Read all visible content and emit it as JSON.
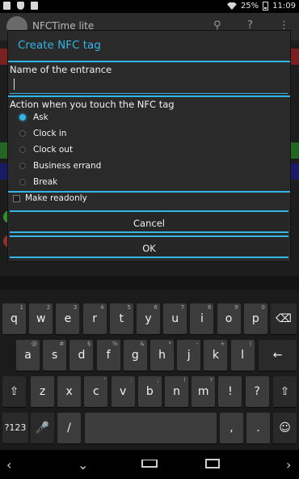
{
  "status_bar": {
    "left_icons": [
      "image-icon",
      "shield-icon",
      "bag-icon"
    ],
    "battery": "25%",
    "time": "11:09"
  },
  "background_app": {
    "title": "NFCTime lite",
    "toolbar_icons": [
      "search-icon",
      "help-icon",
      "overflow-menu-icon"
    ]
  },
  "dialog": {
    "title": "Create NFC tag",
    "name_label": "Name of the entrance",
    "name_value": "",
    "action_label": "Action when you touch the NFC tag",
    "options": [
      {
        "label": "Ask",
        "checked": true
      },
      {
        "label": "Clock in",
        "checked": false
      },
      {
        "label": "Clock out",
        "checked": false
      },
      {
        "label": "Business errand",
        "checked": false
      },
      {
        "label": "Break",
        "checked": false
      }
    ],
    "readonly_label": "Make readonly",
    "readonly_checked": false,
    "cancel_label": "Cancel",
    "ok_label": "OK"
  },
  "keyboard": {
    "row1": [
      {
        "key": "q",
        "hint": "1"
      },
      {
        "key": "w",
        "hint": "2"
      },
      {
        "key": "e",
        "hint": "3"
      },
      {
        "key": "r",
        "hint": "4"
      },
      {
        "key": "t",
        "hint": "5"
      },
      {
        "key": "y",
        "hint": "6"
      },
      {
        "key": "u",
        "hint": "7"
      },
      {
        "key": "i",
        "hint": "8"
      },
      {
        "key": "o",
        "hint": "9"
      },
      {
        "key": "p",
        "hint": "0"
      }
    ],
    "row2": [
      {
        "key": "a",
        "hint": "@"
      },
      {
        "key": "s",
        "hint": "#"
      },
      {
        "key": "d",
        "hint": "$"
      },
      {
        "key": "f",
        "hint": "%"
      },
      {
        "key": "g",
        "hint": "&"
      },
      {
        "key": "h",
        "hint": "*"
      },
      {
        "key": "j",
        "hint": "-"
      },
      {
        "key": "k",
        "hint": "+"
      },
      {
        "key": "l",
        "hint": "("
      }
    ],
    "row3": [
      {
        "key": "z",
        "hint": ""
      },
      {
        "key": "x",
        "hint": ""
      },
      {
        "key": "c",
        "hint": "'"
      },
      {
        "key": "v",
        "hint": ":"
      },
      {
        "key": "b",
        "hint": ";"
      },
      {
        "key": "n",
        "hint": "!"
      },
      {
        "key": "m",
        "hint": "?"
      },
      {
        "key": "!",
        "hint": ""
      },
      {
        "key": "?",
        "hint": ""
      }
    ],
    "symbols_label": "?123",
    "slash_label": "/",
    "comma_label": ",",
    "period_label": ".",
    "icons": [
      "backspace-icon",
      "enter-icon",
      "shift-icon",
      "microphone-icon",
      "emoji-icon"
    ]
  },
  "nav_bar": {
    "icons": [
      "back-left-icon",
      "hide-keyboard-icon",
      "home-icon",
      "recent-apps-icon",
      "forward-right-icon"
    ]
  },
  "colors": {
    "accent": "#33b5e5",
    "dialog_bg": "#2a2a2a",
    "key_bg": "#3c3c3c"
  }
}
